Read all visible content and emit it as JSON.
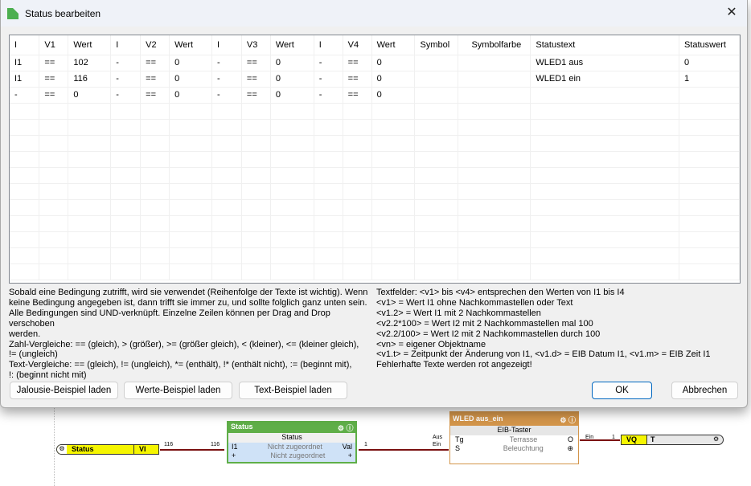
{
  "dialog": {
    "title": "Status bearbeiten",
    "close_icon": "close-icon"
  },
  "table": {
    "headers": [
      "I",
      "V1",
      "Wert",
      "I",
      "V2",
      "Wert",
      "I",
      "V3",
      "Wert",
      "I",
      "V4",
      "Wert",
      "Symbol",
      "Symbolfarbe",
      "Statustext",
      "Statuswert"
    ],
    "rows": [
      [
        "I1",
        "==",
        "102",
        "-",
        "==",
        "0",
        "-",
        "==",
        "0",
        "-",
        "==",
        "0",
        "",
        "",
        "WLED1 aus",
        "0"
      ],
      [
        "I1",
        "==",
        "116",
        "-",
        "==",
        "0",
        "-",
        "==",
        "0",
        "-",
        "==",
        "0",
        "",
        "",
        "WLED1 ein",
        "1"
      ],
      [
        "-",
        "==",
        "0",
        "-",
        "==",
        "0",
        "-",
        "==",
        "0",
        "-",
        "==",
        "0",
        "",
        "",
        "",
        ""
      ]
    ]
  },
  "help_left": [
    "Sobald eine Bedingung zutrifft, wird sie verwendet (Reihenfolge der Texte ist wichtig). Wenn",
    "keine Bedingung angegeben ist, dann trifft sie immer zu, und sollte folglich ganz unten sein.",
    "Alle Bedingungen sind UND-verknüpft. Einzelne Zeilen können per Drag and Drop verschoben",
    "werden.",
    "Zahl-Vergleiche: == (gleich), > (größer), >= (größer gleich), < (kleiner), <= (kleiner gleich),",
    "!= (ungleich)",
    "Text-Vergleiche: == (gleich), != (ungleich), *= (enthält), !* (enthält nicht), := (beginnt mit),",
    "!: (beginnt nicht mit)"
  ],
  "help_right": [
    "Textfelder: <v1> bis <v4> entsprechen den Werten von I1 bis I4",
    "<v1> = Wert I1 ohne Nachkommastellen oder Text",
    "<v1.2> = Wert I1 mit 2 Nachkommastellen",
    "<v2.2*100> = Wert I2 mit 2 Nachkommastellen mal 100",
    "<v2.2/100> = Wert I2 mit 2 Nachkommastellen durch 100",
    "<vn> = eigener Objektname",
    "<v1.t> = Zeitpunkt der Änderung von I1, <v1.d> = EIB Datum I1, <v1.m> = EIB Zeit I1",
    "Fehlerhafte Texte werden rot angezeigt!"
  ],
  "buttons": {
    "jalousie": "Jalousie-Beispiel laden",
    "werte": "Werte-Beispiel laden",
    "text": "Text-Beispiel laden",
    "ok": "OK",
    "cancel": "Abbrechen"
  },
  "canvas": {
    "input_node": {
      "name": "Status",
      "port": "VI",
      "value_out": "116"
    },
    "status_node": {
      "title": "Status",
      "subtitle": "Status",
      "in_port": "I1",
      "in_value": "116",
      "row1": "Nicht zugeordnet",
      "row2": "Nicht zugeordnet",
      "out_port": "Val",
      "out_value": "1",
      "color": "#5fae48"
    },
    "wled_node": {
      "title": "WLED aus_ein",
      "subtitle": "EIB-Taster",
      "in1_label": "Aus",
      "in1": "Tg",
      "row1": "Terrasse",
      "out1": "O",
      "in2_label": "Ein",
      "in2": "S",
      "row2": "Beleuchtung",
      "out_label": "Ein",
      "out_value": "1",
      "color": "#d3954a"
    },
    "output_node": {
      "port": "VQ",
      "name": "T"
    }
  }
}
